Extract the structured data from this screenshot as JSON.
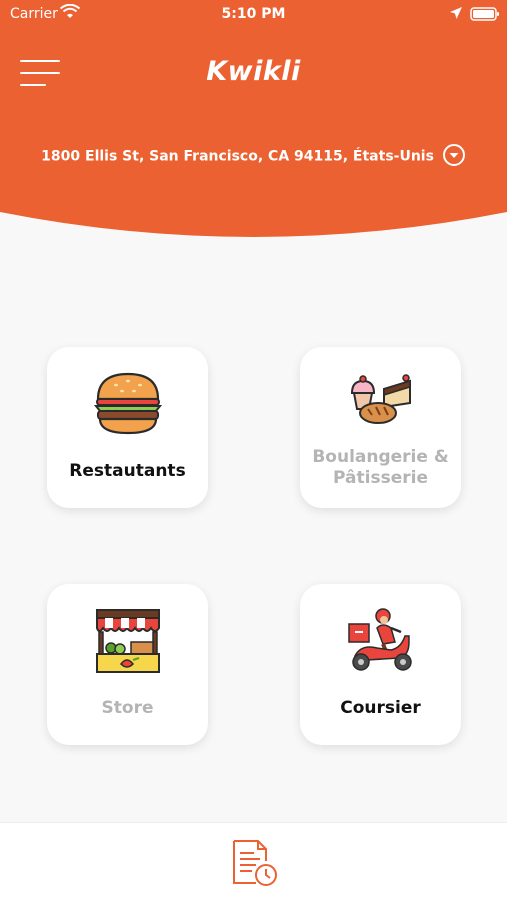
{
  "status_bar": {
    "carrier": "Carrier",
    "time": "5:10 PM"
  },
  "header": {
    "brand": "Kwikli",
    "address": "1800 Ellis St, San Francisco, CA 94115, États-Unis",
    "color": "#ec6131"
  },
  "categories": [
    {
      "label": "Restautants",
      "icon": "burger-icon",
      "active": true
    },
    {
      "label_line1": "Boulangerie &",
      "label_line2": "Pâtisserie",
      "icon": "bakery-icon",
      "active": false
    },
    {
      "label": "Store",
      "icon": "market-stall-icon",
      "active": false
    },
    {
      "label": "Coursier",
      "icon": "delivery-scooter-icon",
      "active": true
    }
  ],
  "bottom_bar": {
    "icon": "order-history-icon"
  },
  "colors": {
    "accent": "#ec6131",
    "inactive_text": "#b4b4b4",
    "active_text": "#111111"
  }
}
